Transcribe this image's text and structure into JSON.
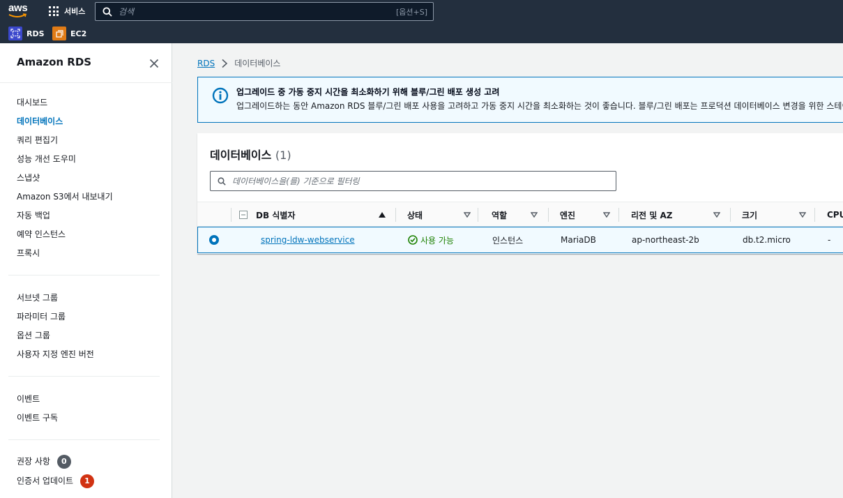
{
  "topnav": {
    "logo_text": "aws",
    "services_label": "서비스",
    "search_placeholder": "검색",
    "search_shortcut": "[옵션+S]",
    "favorites": [
      {
        "label": "RDS",
        "color": "#3b48cc",
        "icon": "rds-icon"
      },
      {
        "label": "EC2",
        "color": "#e07b16",
        "icon": "ec2-icon"
      }
    ]
  },
  "sidebar": {
    "title": "Amazon RDS",
    "group1": [
      "대시보드",
      "데이터베이스",
      "쿼리 편집기",
      "성능 개선 도우미",
      "스냅샷",
      "Amazon S3에서 내보내기",
      "자동 백업",
      "예약 인스턴스",
      "프록시"
    ],
    "active_item": "데이터베이스",
    "group2": [
      "서브넷 그룹",
      "파라미터 그룹",
      "옵션 그룹",
      "사용자 지정 엔진 버전"
    ],
    "group3": [
      "이벤트",
      "이벤트 구독"
    ],
    "group4": [
      {
        "label": "권장 사항",
        "badge": "0",
        "badge_color": "#545b64"
      },
      {
        "label": "인증서 업데이트",
        "badge": "1",
        "badge_color": "#d13212"
      }
    ]
  },
  "breadcrumb": {
    "root": "RDS",
    "current": "데이터베이스"
  },
  "info_banner": {
    "title": "업그레이드 중 가동 중지 시간을 최소화하기 위해 블루/그린 배포 생성 고려",
    "body": "업그레이드하는 동안 Amazon RDS 블루/그린 배포 사용을 고려하고 가동 중지 시간을 최소화하는 것이 좋습니다. 블루/그린 배포는 프로덕션 데이터베이스 변경을 위한 스테이징"
  },
  "databases": {
    "heading": "데이터베이스",
    "count": "(1)",
    "filter_placeholder": "데이터베이스을(를) 기준으로 필터링",
    "columns": [
      "DB 식별자",
      "상태",
      "역할",
      "엔진",
      "리전 및 AZ",
      "크기",
      "CPU"
    ],
    "rows": [
      {
        "identifier": "spring-ldw-webservice",
        "status": "사용 가능",
        "role": "인스턴스",
        "engine": "MariaDB",
        "region_az": "ap-northeast-2b",
        "size": "db.t2.micro",
        "cpu": "-"
      }
    ]
  }
}
